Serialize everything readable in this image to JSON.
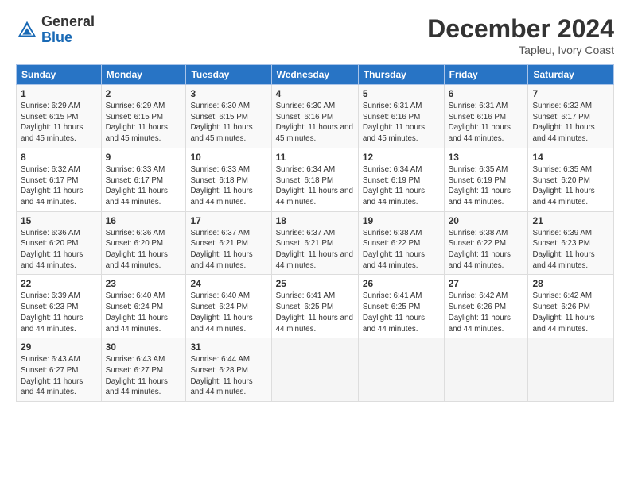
{
  "header": {
    "logo_general": "General",
    "logo_blue": "Blue",
    "main_title": "December 2024",
    "subtitle": "Tapleu, Ivory Coast"
  },
  "calendar": {
    "days_of_week": [
      "Sunday",
      "Monday",
      "Tuesday",
      "Wednesday",
      "Thursday",
      "Friday",
      "Saturday"
    ],
    "weeks": [
      [
        {
          "day": "1",
          "sunrise": "6:29 AM",
          "sunset": "6:15 PM",
          "daylight": "11 hours and 45 minutes."
        },
        {
          "day": "2",
          "sunrise": "6:29 AM",
          "sunset": "6:15 PM",
          "daylight": "11 hours and 45 minutes."
        },
        {
          "day": "3",
          "sunrise": "6:30 AM",
          "sunset": "6:15 PM",
          "daylight": "11 hours and 45 minutes."
        },
        {
          "day": "4",
          "sunrise": "6:30 AM",
          "sunset": "6:16 PM",
          "daylight": "11 hours and 45 minutes."
        },
        {
          "day": "5",
          "sunrise": "6:31 AM",
          "sunset": "6:16 PM",
          "daylight": "11 hours and 45 minutes."
        },
        {
          "day": "6",
          "sunrise": "6:31 AM",
          "sunset": "6:16 PM",
          "daylight": "11 hours and 44 minutes."
        },
        {
          "day": "7",
          "sunrise": "6:32 AM",
          "sunset": "6:17 PM",
          "daylight": "11 hours and 44 minutes."
        }
      ],
      [
        {
          "day": "8",
          "sunrise": "6:32 AM",
          "sunset": "6:17 PM",
          "daylight": "11 hours and 44 minutes."
        },
        {
          "day": "9",
          "sunrise": "6:33 AM",
          "sunset": "6:17 PM",
          "daylight": "11 hours and 44 minutes."
        },
        {
          "day": "10",
          "sunrise": "6:33 AM",
          "sunset": "6:18 PM",
          "daylight": "11 hours and 44 minutes."
        },
        {
          "day": "11",
          "sunrise": "6:34 AM",
          "sunset": "6:18 PM",
          "daylight": "11 hours and 44 minutes."
        },
        {
          "day": "12",
          "sunrise": "6:34 AM",
          "sunset": "6:19 PM",
          "daylight": "11 hours and 44 minutes."
        },
        {
          "day": "13",
          "sunrise": "6:35 AM",
          "sunset": "6:19 PM",
          "daylight": "11 hours and 44 minutes."
        },
        {
          "day": "14",
          "sunrise": "6:35 AM",
          "sunset": "6:20 PM",
          "daylight": "11 hours and 44 minutes."
        }
      ],
      [
        {
          "day": "15",
          "sunrise": "6:36 AM",
          "sunset": "6:20 PM",
          "daylight": "11 hours and 44 minutes."
        },
        {
          "day": "16",
          "sunrise": "6:36 AM",
          "sunset": "6:20 PM",
          "daylight": "11 hours and 44 minutes."
        },
        {
          "day": "17",
          "sunrise": "6:37 AM",
          "sunset": "6:21 PM",
          "daylight": "11 hours and 44 minutes."
        },
        {
          "day": "18",
          "sunrise": "6:37 AM",
          "sunset": "6:21 PM",
          "daylight": "11 hours and 44 minutes."
        },
        {
          "day": "19",
          "sunrise": "6:38 AM",
          "sunset": "6:22 PM",
          "daylight": "11 hours and 44 minutes."
        },
        {
          "day": "20",
          "sunrise": "6:38 AM",
          "sunset": "6:22 PM",
          "daylight": "11 hours and 44 minutes."
        },
        {
          "day": "21",
          "sunrise": "6:39 AM",
          "sunset": "6:23 PM",
          "daylight": "11 hours and 44 minutes."
        }
      ],
      [
        {
          "day": "22",
          "sunrise": "6:39 AM",
          "sunset": "6:23 PM",
          "daylight": "11 hours and 44 minutes."
        },
        {
          "day": "23",
          "sunrise": "6:40 AM",
          "sunset": "6:24 PM",
          "daylight": "11 hours and 44 minutes."
        },
        {
          "day": "24",
          "sunrise": "6:40 AM",
          "sunset": "6:24 PM",
          "daylight": "11 hours and 44 minutes."
        },
        {
          "day": "25",
          "sunrise": "6:41 AM",
          "sunset": "6:25 PM",
          "daylight": "11 hours and 44 minutes."
        },
        {
          "day": "26",
          "sunrise": "6:41 AM",
          "sunset": "6:25 PM",
          "daylight": "11 hours and 44 minutes."
        },
        {
          "day": "27",
          "sunrise": "6:42 AM",
          "sunset": "6:26 PM",
          "daylight": "11 hours and 44 minutes."
        },
        {
          "day": "28",
          "sunrise": "6:42 AM",
          "sunset": "6:26 PM",
          "daylight": "11 hours and 44 minutes."
        }
      ],
      [
        {
          "day": "29",
          "sunrise": "6:43 AM",
          "sunset": "6:27 PM",
          "daylight": "11 hours and 44 minutes."
        },
        {
          "day": "30",
          "sunrise": "6:43 AM",
          "sunset": "6:27 PM",
          "daylight": "11 hours and 44 minutes."
        },
        {
          "day": "31",
          "sunrise": "6:44 AM",
          "sunset": "6:28 PM",
          "daylight": "11 hours and 44 minutes."
        },
        null,
        null,
        null,
        null
      ]
    ]
  }
}
